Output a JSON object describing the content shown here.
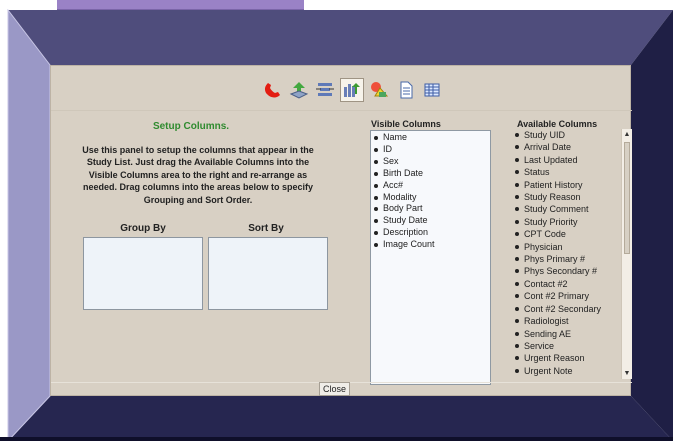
{
  "toolbar": {
    "icons": [
      "phone-icon",
      "import-icon",
      "align-icon",
      "columns-icon",
      "shapes-icon",
      "document-icon",
      "grid-icon"
    ]
  },
  "setup": {
    "title": "Setup Columns.",
    "description": "Use this panel to setup the columns that appear in the Study List. Just drag the Available Columns into the Visible Columns area to the right and re-arrange as needed. Drag columns into the areas below to specify Grouping and Sort Order.",
    "group_by": "Group By",
    "sort_by": "Sort By"
  },
  "visible_columns": {
    "title": "Visible Columns",
    "items": [
      "Name",
      "ID",
      "Sex",
      "Birth Date",
      "Acc#",
      "Modality",
      "Body Part",
      "Study Date",
      "Description",
      "Image Count"
    ]
  },
  "available_columns": {
    "title": "Available Columns",
    "items": [
      "Study UID",
      "Arrival Date",
      "Last Updated",
      "Status",
      "Patient History",
      "Study Reason",
      "Study Comment",
      "Study Priority",
      "CPT Code",
      "Physician",
      "Phys Primary #",
      "Phys Secondary #",
      "Contact #2",
      "Cont #2 Primary",
      "Cont #2 Secondary",
      "Radiologist",
      "Sending AE",
      "Service",
      "Urgent Reason",
      "Urgent Note"
    ]
  },
  "footer": {
    "close_label": "Close"
  },
  "colors": {
    "panel": "#d8d0c4",
    "title_green": "#2f8b2f",
    "frame_dark": "#23234a",
    "frame_light": "#8f8cb5",
    "tab": "#9a82c6"
  }
}
